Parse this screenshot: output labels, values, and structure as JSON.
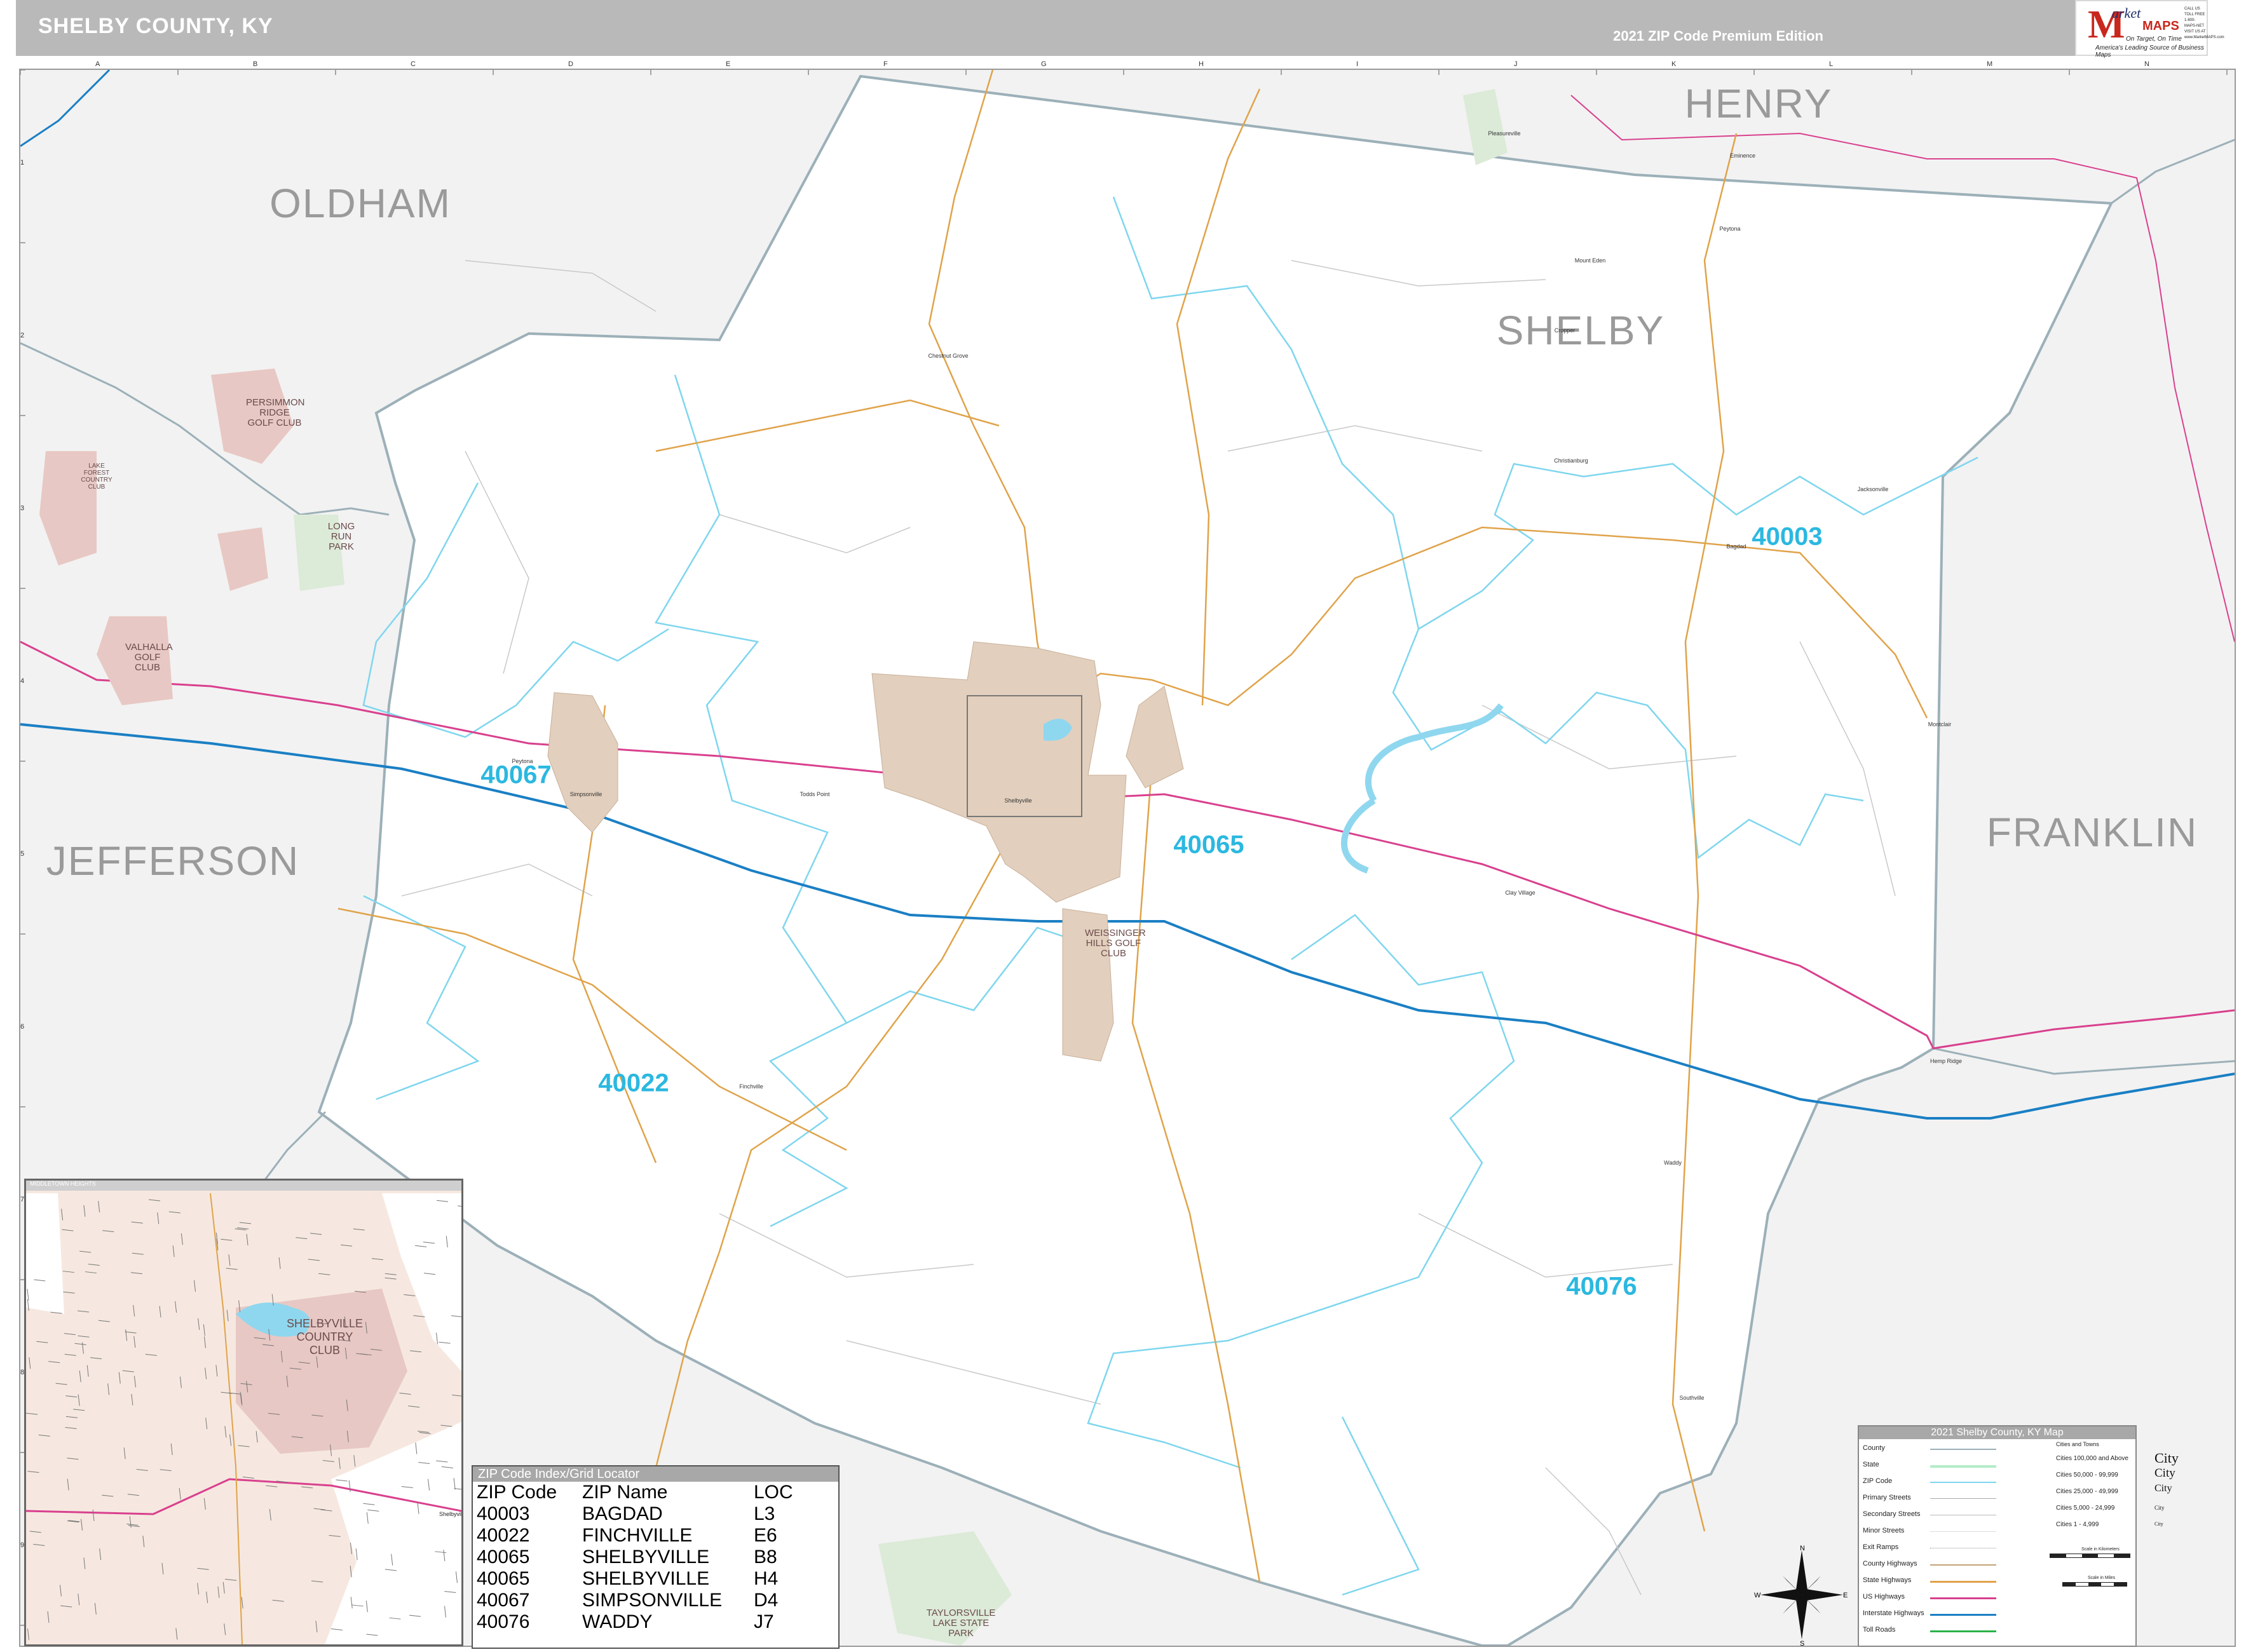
{
  "header": {
    "title": "SHELBY COUNTY, KY",
    "edition": "2021 ZIP Code Premium Edition"
  },
  "logo": {
    "m": "M",
    "market": "arket",
    "maps": "MAPS",
    "tagline_1": "On Target, On Time",
    "tagline_2": "America's Leading Source of Business Maps",
    "contact": "CALL US TOLL FREE 1-800-MAPS-NET VISIT US AT www.MarketMAPS.com"
  },
  "grid": {
    "columns": [
      "A",
      "B",
      "C",
      "D",
      "E",
      "F",
      "G",
      "H",
      "I",
      "J",
      "K",
      "L",
      "M",
      "N"
    ],
    "rows": [
      "1",
      "2",
      "3",
      "4",
      "5",
      "6",
      "7",
      "8",
      "9"
    ]
  },
  "counties": [
    {
      "name": "HENRY",
      "anchor": "top-center-right"
    },
    {
      "name": "OLDHAM",
      "anchor": "top-left"
    },
    {
      "name": "SHELBY",
      "anchor": "upper-right"
    },
    {
      "name": "JEFFERSON",
      "anchor": "left"
    },
    {
      "name": "FRANKLIN",
      "anchor": "right"
    }
  ],
  "zip_labels": [
    "40003",
    "40067",
    "40065",
    "40022",
    "40076"
  ],
  "parks": [
    "PERSIMMON RIDGE GOLF CLUB",
    "LAKE FOREST COUNTRY CLUB",
    "LONG RUN PARK",
    "VALHALLA GOLF CLUB",
    "WEISSINGER HILLS GOLF CLUB",
    "TAYLORSVILLE LAKE STATE PARK"
  ],
  "towns": [
    "Peytona",
    "Simpsonville",
    "Shelbyville",
    "Finchville",
    "Bagdad",
    "Waddy",
    "Chestnut Grove",
    "Cropper",
    "Christianburg",
    "Jacksonville",
    "Pleasureville",
    "Eminence",
    "Clay Village",
    "Peytona",
    "Montclair",
    "Southville",
    "Hemp Ridge",
    "Mount Eden",
    "Todds Point"
  ],
  "inset": {
    "title": "MIDDLETOWN HEIGHTS",
    "club": "SHELBYVILLE\nCOUNTRY\nCLUB",
    "city": "Shelbyville"
  },
  "zip_index": {
    "title": "ZIP Code Index/Grid Locator",
    "headers": {
      "zip": "ZIP Code",
      "name": "ZIP Name",
      "loc": "LOC"
    },
    "rows": [
      {
        "zip": "40003",
        "name": "BAGDAD",
        "loc": "L3"
      },
      {
        "zip": "40022",
        "name": "FINCHVILLE",
        "loc": "E6"
      },
      {
        "zip": "40065",
        "name": "SHELBYVILLE",
        "loc": "B8"
      },
      {
        "zip": "40065",
        "name": "SHELBYVILLE",
        "loc": "H4"
      },
      {
        "zip": "40067",
        "name": "SIMPSONVILLE",
        "loc": "D4"
      },
      {
        "zip": "40076",
        "name": "WADDY",
        "loc": "J7"
      }
    ]
  },
  "legend": {
    "title": "2021 Shelby County, KY Map",
    "items": [
      "County",
      "State",
      "ZIP Code",
      "Primary Streets",
      "Secondary Streets",
      "Minor Streets",
      "Exit Ramps",
      "County Highways",
      "State Highways",
      "US Highways",
      "Interstate Highways",
      "Toll Roads"
    ],
    "cities_header": "Cities and Towns",
    "city_rows": [
      "Cities 100,000 and Above",
      "Cities 50,000 - 99,999",
      "Cities 25,000 - 49,999",
      "Cities 5,000 - 24,999",
      "Cities 1 - 4,999"
    ],
    "city_syms": [
      "City",
      "City",
      "City",
      "City",
      "City"
    ],
    "scale_km": "Scale in Kilometers",
    "scale_mi": "Scale in Miles"
  },
  "compass": {
    "n": "N",
    "s": "S",
    "e": "E",
    "w": "W"
  },
  "colors": {
    "zip_label": "#2bb8e0",
    "zip_boundary": "#7fd6ee",
    "interstate": "#1a7fc4",
    "us_highway": "#d9408e",
    "state_highway": "#e0a34a",
    "county_boundary": "#9cb0b8",
    "urban": "#e2cfbd",
    "park": "#e8c8c4",
    "water": "#8fd7ef"
  }
}
